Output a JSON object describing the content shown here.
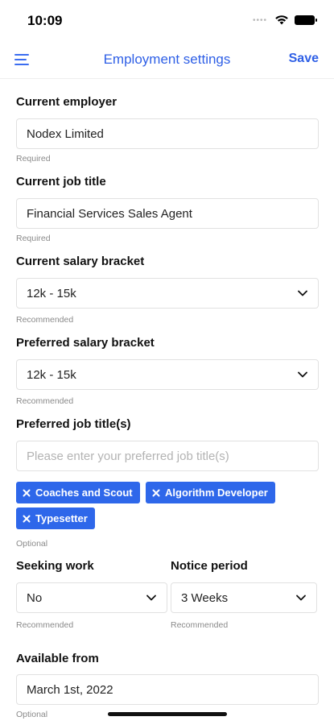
{
  "status_bar": {
    "time": "10:09",
    "signal_icon": "dots-icon",
    "wifi_icon": "wifi-icon",
    "battery_icon": "battery-icon"
  },
  "nav": {
    "menu_icon": "menu-icon",
    "title": "Employment settings",
    "save_label": "Save"
  },
  "accent_color": "#2e5fe6",
  "fields": {
    "current_employer": {
      "label": "Current employer",
      "value": "Nodex Limited",
      "helper": "Required"
    },
    "current_job_title": {
      "label": "Current job title",
      "value": "Financial Services Sales Agent",
      "helper": "Required"
    },
    "current_salary": {
      "label": "Current salary bracket",
      "value": "12k - 15k",
      "helper": "Recommended"
    },
    "preferred_salary": {
      "label": "Preferred salary bracket",
      "value": "12k - 15k",
      "helper": "Recommended"
    },
    "preferred_titles": {
      "label": "Preferred job title(s)",
      "placeholder": "Please enter your preferred job title(s)",
      "helper": "Optional",
      "chips": [
        "Coaches and Scout",
        "Algorithm Developer",
        "Typesetter"
      ]
    },
    "seeking_work": {
      "label": "Seeking work",
      "value": "No",
      "helper": "Recommended"
    },
    "notice_period": {
      "label": "Notice period",
      "value": "3 Weeks",
      "helper": "Recommended"
    },
    "available_from": {
      "label": "Available from",
      "value": "March 1st, 2022",
      "helper": "Optional"
    }
  }
}
